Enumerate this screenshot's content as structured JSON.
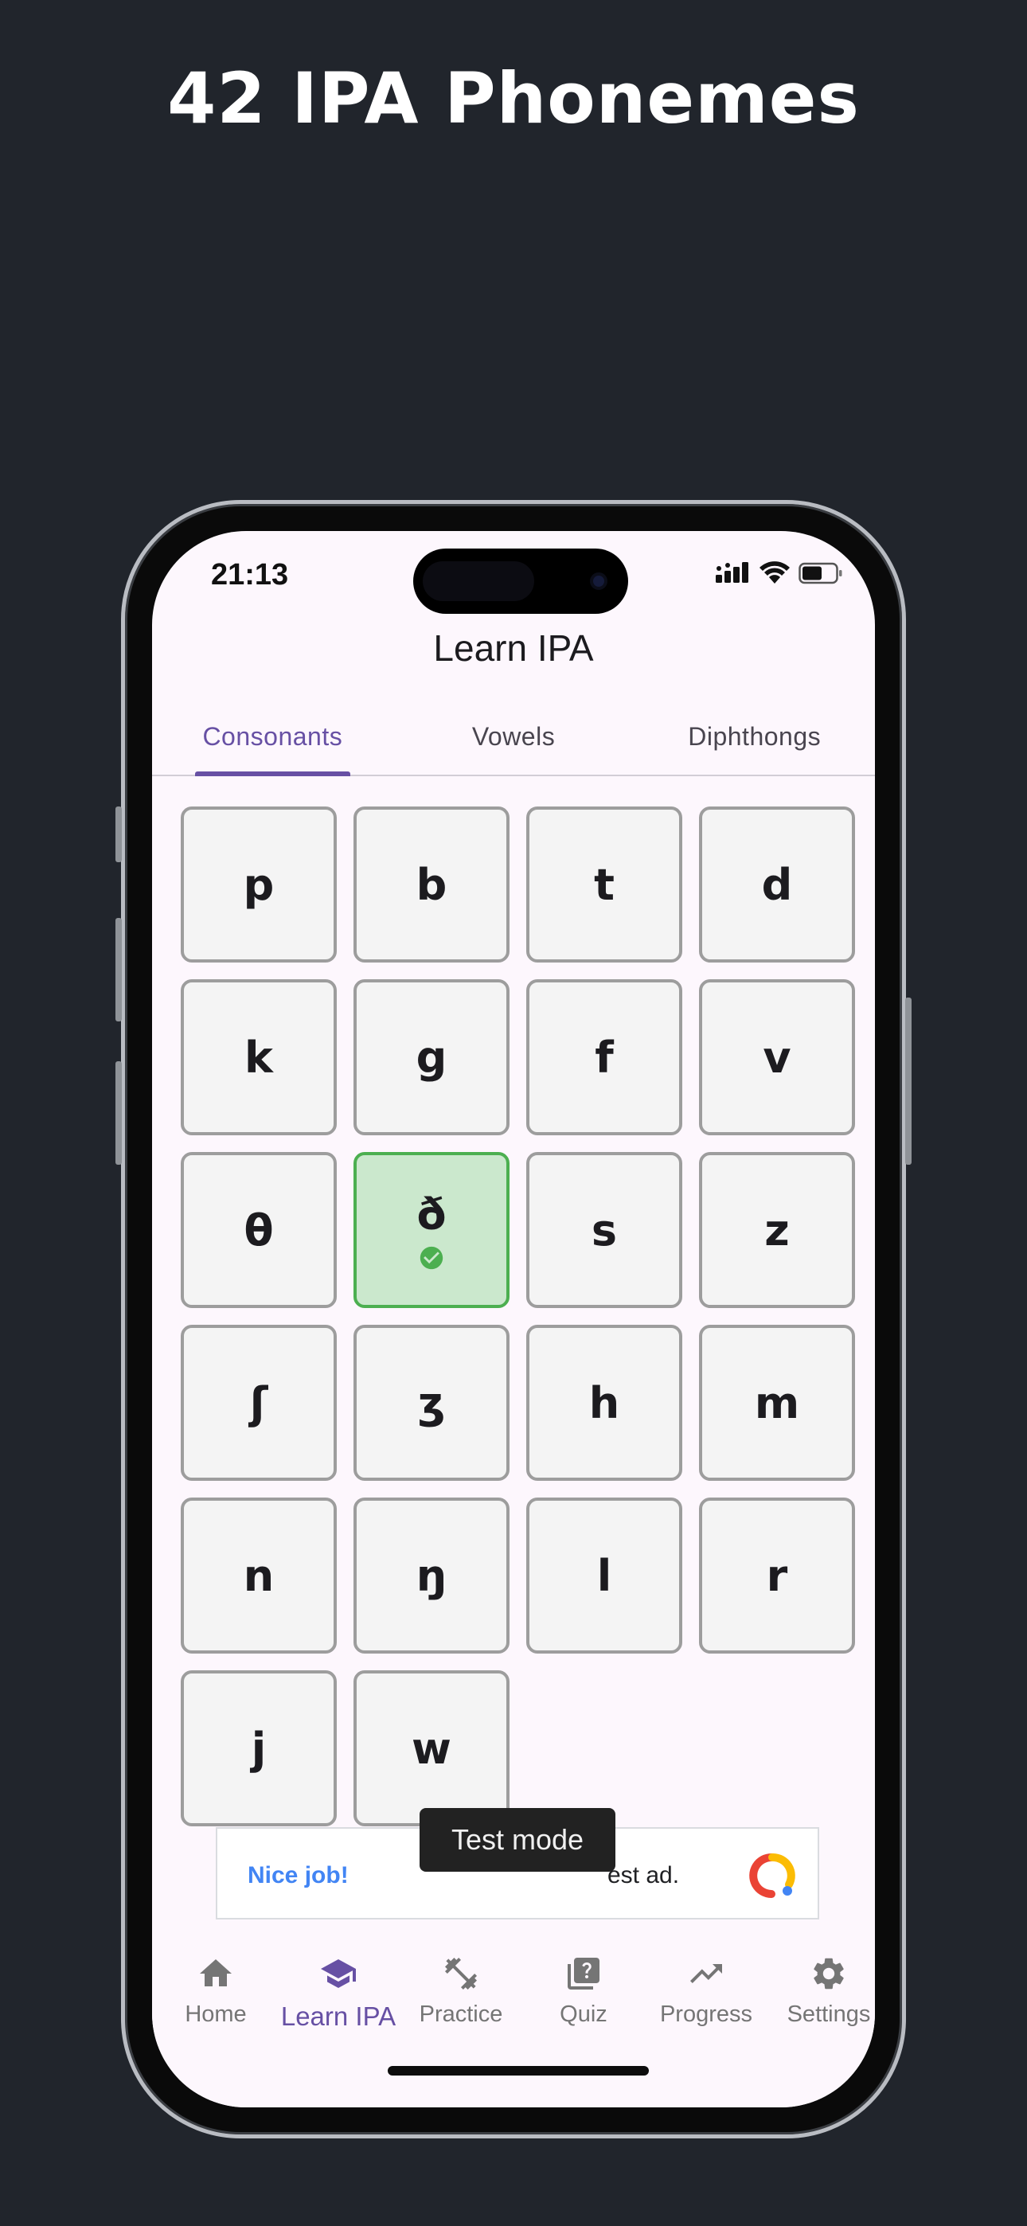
{
  "headline": "42 IPA Phonemes",
  "status_bar": {
    "time": "21:13"
  },
  "app_bar": {
    "title": "Learn IPA"
  },
  "tabs": [
    {
      "label": "Consonants",
      "active": true
    },
    {
      "label": "Vowels",
      "active": false
    },
    {
      "label": "Diphthongs",
      "active": false
    }
  ],
  "phonemes": [
    "p",
    "b",
    "t",
    "d",
    "k",
    "g",
    "f",
    "v",
    "θ",
    "ð",
    "s",
    "z",
    "ʃ",
    "ʒ",
    "h",
    "m",
    "n",
    "ŋ",
    "l",
    "r",
    "j",
    "w"
  ],
  "learned": [
    "ð"
  ],
  "ad": {
    "headline": "Nice job!",
    "text": "est ad."
  },
  "toast": "Test mode",
  "bottom_nav": [
    {
      "label": "Home",
      "icon": "home-icon",
      "active": false
    },
    {
      "label": "Learn IPA",
      "icon": "school-icon",
      "active": true
    },
    {
      "label": "Practice",
      "icon": "fitness-icon",
      "active": false
    },
    {
      "label": "Quiz",
      "icon": "quiz-icon",
      "active": false
    },
    {
      "label": "Progress",
      "icon": "trending-up-icon",
      "active": false
    },
    {
      "label": "Settings",
      "icon": "gear-icon",
      "active": false
    }
  ],
  "colors": {
    "primary": "#6750a4",
    "learned_bg": "#cbe8cd",
    "learned_border": "#4caf50",
    "backdrop": "#21252c"
  }
}
